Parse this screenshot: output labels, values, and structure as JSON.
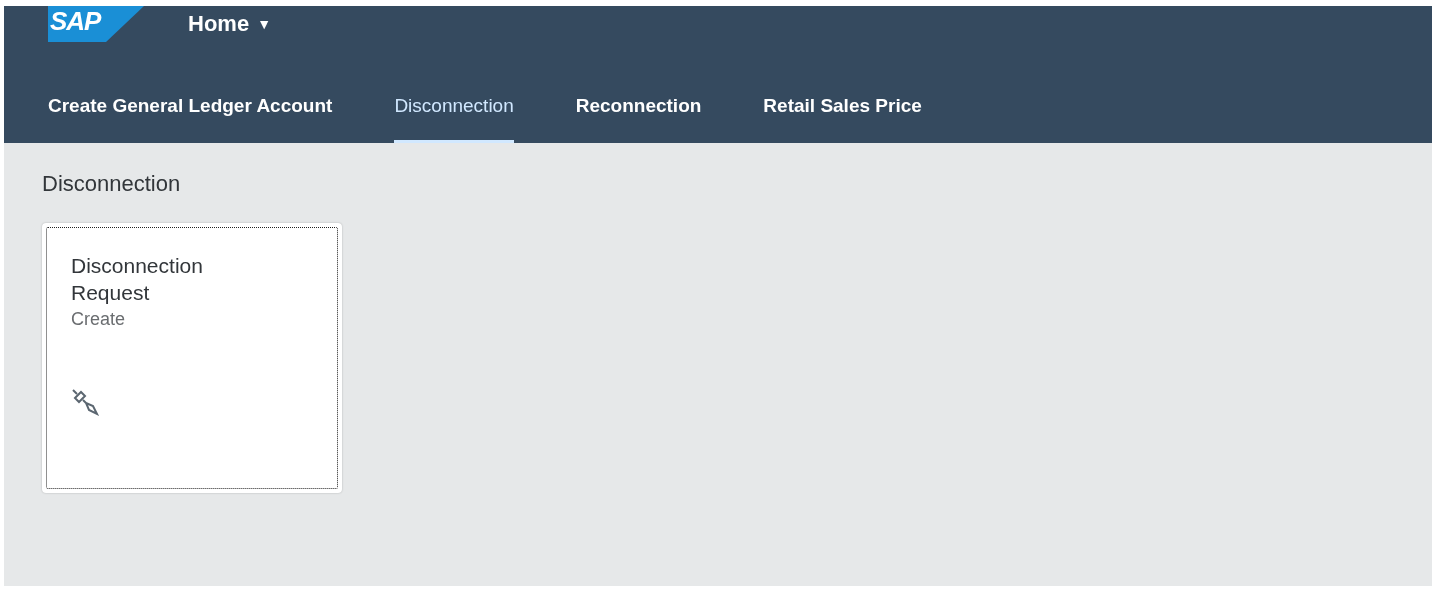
{
  "header": {
    "logo": "SAP",
    "title": "Home",
    "caret": "▼"
  },
  "tabs": [
    {
      "label": "Create General Ledger Account",
      "selected": false
    },
    {
      "label": "Disconnection",
      "selected": true
    },
    {
      "label": "Reconnection",
      "selected": false
    },
    {
      "label": "Retail Sales Price",
      "selected": false
    }
  ],
  "section": {
    "title": "Disconnection",
    "tiles": [
      {
        "title": "Disconnection Request",
        "subtitle": "Create",
        "focused": true
      }
    ]
  }
}
